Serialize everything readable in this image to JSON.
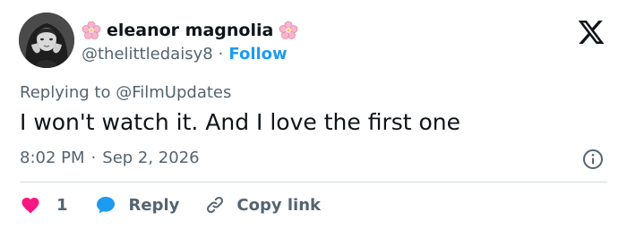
{
  "author": {
    "display_name": "eleanor magnolia",
    "handle": "@thelittledaisy8",
    "separator": "·",
    "follow_label": "Follow",
    "flower_icon": "cherry-blossom-emoji",
    "avatar": "profile-photo"
  },
  "brand": {
    "logo": "x-logo-icon"
  },
  "tweet": {
    "replying_prefix": "Replying to",
    "replying_to": "@FilmUpdates",
    "text": "I won't watch it. And I love the first one",
    "time": "8:02 PM",
    "separator": "·",
    "date": "Sep 2, 2026"
  },
  "actions": {
    "like_count": "1",
    "reply_label": "Reply",
    "copy_link_label": "Copy link"
  },
  "colors": {
    "text": "#0f1419",
    "muted": "#536471",
    "accent": "#1d9bf0",
    "like": "#f91880",
    "divider": "#cfd9de"
  }
}
